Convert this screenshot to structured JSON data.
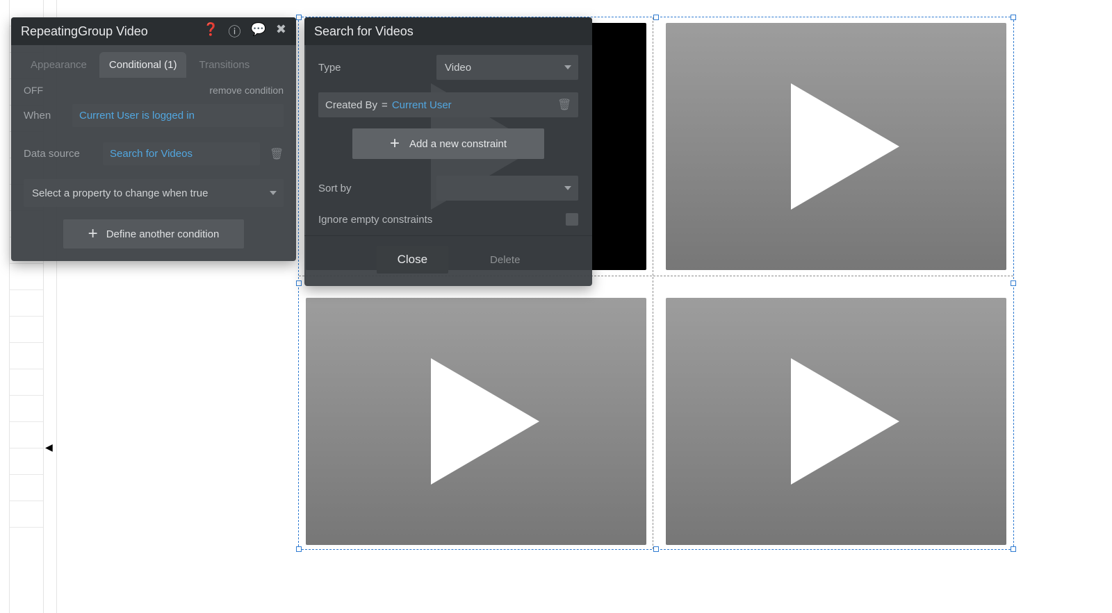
{
  "panel1": {
    "title": "RepeatingGroup Video",
    "tabs": {
      "appearance": "Appearance",
      "conditional": "Conditional (1)",
      "transitions": "Transitions"
    },
    "off_label": "OFF",
    "remove_label": "remove condition",
    "when_label": "When",
    "when_expr": "Current User is logged in",
    "datasource_label": "Data source",
    "datasource_expr": "Search for Videos",
    "prop_select_placeholder": "Select a property to change when true",
    "define_btn": "Define another condition"
  },
  "panel2": {
    "title": "Search for Videos",
    "type_label": "Type",
    "type_value": "Video",
    "constraint_field": "Created By",
    "constraint_op": "=",
    "constraint_value": "Current User",
    "add_constraint": "Add a new constraint",
    "sort_label": "Sort by",
    "sort_value": "",
    "ignore_label": "Ignore empty constraints",
    "close": "Close",
    "delete": "Delete"
  }
}
